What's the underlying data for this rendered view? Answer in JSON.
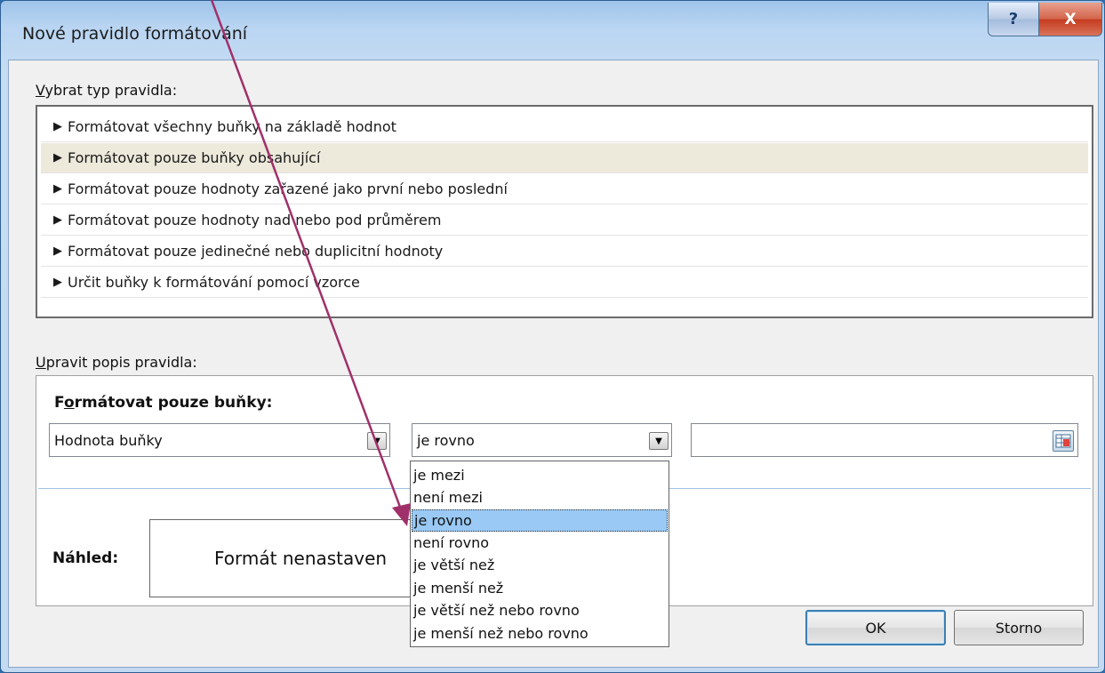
{
  "window": {
    "title": "Nové pravidlo formátování",
    "help_label": "?",
    "close_label": "X"
  },
  "rule_type": {
    "label_accel": "V",
    "label_rest": "ybrat typ pravidla:",
    "items": [
      "Formátovat všechny buňky na základě hodnot",
      "Formátovat pouze buňky obsahující",
      "Formátovat pouze hodnoty zařazené jako první nebo poslední",
      "Formátovat pouze hodnoty nad nebo pod průměrem",
      "Formátovat pouze jedinečné nebo duplicitní hodnoty",
      "Určit buňky k formátování pomocí vzorce"
    ],
    "selected_index": 1
  },
  "description": {
    "label_accel": "U",
    "label_rest": "pravit popis pravidla:",
    "subtitle_pre": "F",
    "subtitle_accel": "o",
    "subtitle_rest": "rmátovat pouze buňky:",
    "combo1_value": "Hodnota buňky",
    "combo2_value": "je rovno",
    "value_input": "",
    "operators": [
      "je mezi",
      "není mezi",
      "je rovno",
      "není rovno",
      "je větší než",
      "je menší než",
      "je větší než nebo rovno",
      "je menší než nebo rovno"
    ],
    "highlighted_operator_index": 2
  },
  "preview": {
    "label": "Náhled:",
    "text": "Formát nenastaven"
  },
  "buttons": {
    "ok": "OK",
    "cancel": "Storno"
  },
  "colors": {
    "annotation_arrow": "#a0306a",
    "list_selection": "#ede9db",
    "dropdown_highlight": "#99c9f4"
  }
}
